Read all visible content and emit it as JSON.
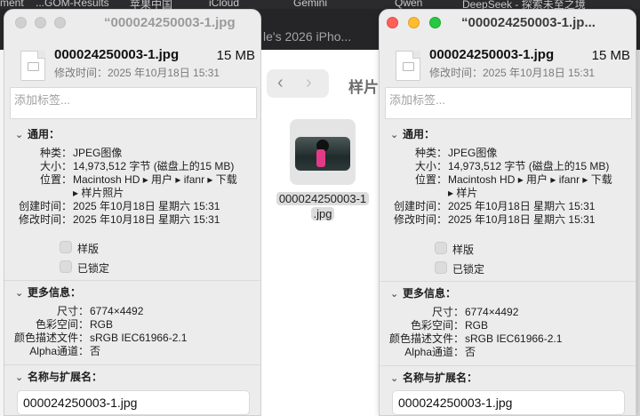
{
  "menubar": {
    "items": [
      "ment",
      "...GOM-Results",
      "苹果中国",
      "iCloud",
      "Gemini",
      "Qwen",
      "DeepSeek - 探索未至之境"
    ]
  },
  "tabbar": {
    "tab_fragment": "le's 2026 iPho..."
  },
  "finder": {
    "back": "‹",
    "forward": "›",
    "folder_name": "样片",
    "file_label_line1": "000024250003-1",
    "file_label_line2": ".jpg"
  },
  "left": {
    "title": "“000024250003-1.jpg",
    "filename": "000024250003-1.jpg",
    "filesize": "15 MB",
    "modified_header": "修改时间：2025 年10月18日 15:31",
    "tags_placeholder": "添加标签...",
    "general": {
      "header": "通用：",
      "kind_k": "种类：",
      "kind_v": "JPEG图像",
      "size_k": "大小：",
      "size_v": "14,973,512 字节 (磁盘上的15 MB)",
      "where_k": "位置：",
      "where_v1": "Macintosh HD ▸ 用户 ▸ ifanr ▸ 下载",
      "where_v2": "▸ 样片照片",
      "created_k": "创建时间：",
      "created_v": "2025 年10月18日 星期六 15:31",
      "modified_k": "修改时间：",
      "modified_v": "2025 年10月18日 星期六 15:31",
      "stationery": "样版",
      "locked": "已锁定"
    },
    "more": {
      "header": "更多信息：",
      "dim_k": "尺寸：",
      "dim_v": "6774×4492",
      "cs_k": "色彩空间：",
      "cs_v": "RGB",
      "prof_k": "颜色描述文件：",
      "prof_v": "sRGB IEC61966-2.1",
      "alpha_k": "Alpha通道：",
      "alpha_v": "否"
    },
    "name": {
      "header": "名称与扩展名：",
      "value": "000024250003-1.jpg"
    }
  },
  "right": {
    "title": "“000024250003-1.jp...",
    "filename": "000024250003-1.jpg",
    "filesize": "15 MB",
    "modified_header": "修改时间：2025 年10月18日 15:31",
    "tags_placeholder": "添加标签...",
    "general": {
      "header": "通用：",
      "kind_k": "种类：",
      "kind_v": "JPEG图像",
      "size_k": "大小：",
      "size_v": "14,973,512 字节 (磁盘上的15 MB)",
      "where_k": "位置：",
      "where_v1": "Macintosh HD ▸ 用户 ▸ ifanr ▸ 下载",
      "where_v2": "▸ 样片",
      "created_k": "创建时间：",
      "created_v": "2025 年10月18日 星期六 15:31",
      "modified_k": "修改时间：",
      "modified_v": "2025 年10月18日 星期六 15:31",
      "stationery": "样版",
      "locked": "已锁定"
    },
    "more": {
      "header": "更多信息：",
      "dim_k": "尺寸：",
      "dim_v": "6774×4492",
      "cs_k": "色彩空间：",
      "cs_v": "RGB",
      "prof_k": "颜色描述文件：",
      "prof_v": "sRGB IEC61966-2.1",
      "alpha_k": "Alpha通道：",
      "alpha_v": "否"
    },
    "name": {
      "header": "名称与扩展名：",
      "value": "000024250003-1.jpg"
    }
  },
  "colors": {
    "close": "#fe5f57",
    "minimize": "#febc2e",
    "zoom": "#28c840",
    "inactive": "#d0d0d0",
    "window_bg": "#ececec"
  }
}
